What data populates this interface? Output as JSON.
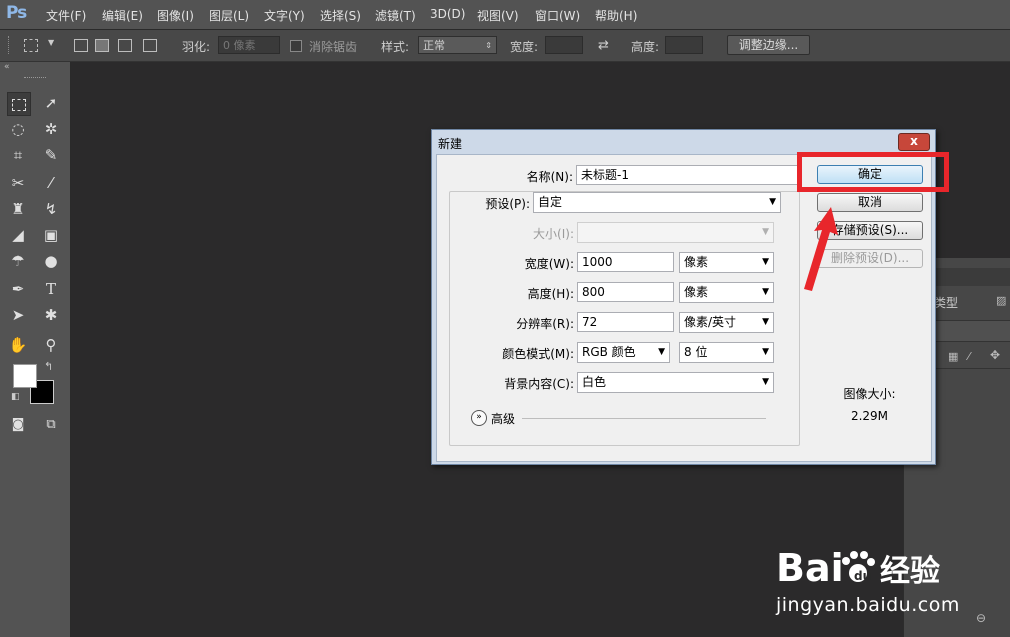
{
  "app": {
    "logo": "Ps"
  },
  "menu": [
    "文件(F)",
    "编辑(E)",
    "图像(I)",
    "图层(L)",
    "文字(Y)",
    "选择(S)",
    "滤镜(T)",
    "3D(D)",
    "视图(V)",
    "窗口(W)",
    "帮助(H)"
  ],
  "options": {
    "feather_label": "羽化:",
    "feather_value": "0 像素",
    "antialias_label": "消除锯齿",
    "style_label": "样式:",
    "style_value": "正常",
    "width_label": "宽度:",
    "height_label": "高度:",
    "refine_button": "调整边缘..."
  },
  "dialog": {
    "title": "新建",
    "close": "x",
    "name_label": "名称(N):",
    "name_value": "未标题-1",
    "preset_label": "预设(P):",
    "preset_value": "自定",
    "size_label": "大小(I):",
    "width_label": "宽度(W):",
    "width_value": "1000",
    "width_unit": "像素",
    "height_label": "高度(H):",
    "height_value": "800",
    "height_unit": "像素",
    "resolution_label": "分辨率(R):",
    "resolution_value": "72",
    "resolution_unit": "像素/英寸",
    "color_mode_label": "颜色模式(M):",
    "color_mode_value": "RGB 颜色",
    "bit_depth_value": "8 位",
    "background_label": "背景内容(C):",
    "background_value": "白色",
    "advanced_label": "高级",
    "ok_button": "确定",
    "cancel_button": "取消",
    "save_preset_button": "存储预设(S)...",
    "delete_preset_button": "删除预设(D)...",
    "image_size_label": "图像大小:",
    "image_size_value": "2.29M"
  },
  "panel": {
    "type_label": "类型"
  },
  "watermark": {
    "brand": "Bai du 经验",
    "url": "jingyan.baidu.com"
  },
  "colors": {
    "accent_red": "#e8262b",
    "dialog_frame": "#cdd9e8",
    "button_default": "#bfe0f5"
  }
}
